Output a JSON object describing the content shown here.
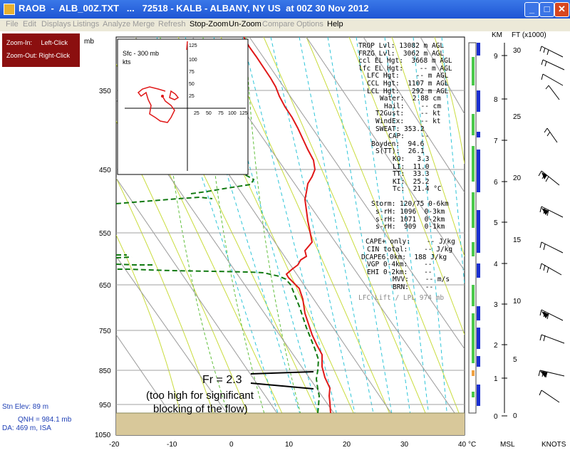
{
  "window": {
    "title": "RAOB  -  ALB_00Z.TXT   ...   72518 - KALB - ALBANY, NY US  at 00Z 30 Nov 2012",
    "buttons": {
      "minimize": "_",
      "maximize": "□",
      "close": "✕"
    }
  },
  "menu": [
    {
      "label": "File",
      "enabled": false
    },
    {
      "label": "Edit",
      "enabled": false
    },
    {
      "label": "Displays",
      "enabled": false
    },
    {
      "label": "Listings",
      "enabled": false
    },
    {
      "label": "Analyze",
      "enabled": false
    },
    {
      "label": "Merge",
      "enabled": false
    },
    {
      "label": "Refresh",
      "enabled": false
    },
    {
      "label": "Stop-Zoom",
      "enabled": true
    },
    {
      "label": "Un-Zoom",
      "enabled": true
    },
    {
      "label": "Compare",
      "enabled": false
    },
    {
      "label": "Options",
      "enabled": false
    },
    {
      "label": "Help",
      "enabled": true
    }
  ],
  "zoom_help": {
    "line1": "Zoom-In:     Left-Click",
    "line2": "Zoom-Out: Right-Click"
  },
  "station": {
    "elev": "Stn Elev: 89 m",
    "qnh": "QNH = 984.1 mb",
    "da": "DA: 469 m, ISA"
  },
  "axes": {
    "pressure_unit": "mb",
    "pressure_ticks": [
      "350",
      "450",
      "550",
      "650",
      "750",
      "850",
      "950",
      "1050"
    ],
    "temp_ticks": [
      "-20",
      "-10",
      "0",
      "10",
      "20",
      "30",
      "40"
    ],
    "temp_unit": "°C",
    "km_label": "KM",
    "ft_label": "FT (x1000)",
    "km_ticks": [
      "9",
      "8",
      "7",
      "6",
      "5",
      "4",
      "3",
      "2",
      "1",
      "0"
    ],
    "ft_ticks": [
      "30",
      "25",
      "20",
      "15",
      "10",
      "5",
      "0"
    ],
    "msl_label": "MSL",
    "knots_label": "KNOTS"
  },
  "hodograph": {
    "title": "Sfc - 300 mb",
    "units": "kts",
    "ticks": [
      "125",
      "100",
      "75",
      "50",
      "25"
    ],
    "xticks": [
      "25",
      "50",
      "75",
      "100",
      "125"
    ]
  },
  "indices": [
    "TROP Lvl: 13082 m AGL",
    "FRZG Lvl:  3062 m AGL",
    "ccl EL Hgt:  3668 m AGL",
    "lfc EL Hgt:    -- m AGL",
    "LFC Hgt:    -- m AGL",
    "CCL Hgt:  1107 m AGL",
    "LCL Hgt:   292 m AGL",
    "Water:  2.88 cm",
    "Hail:    -- cm",
    "T2Gust:    -- kt",
    "WindEx:    -- kt",
    "SWEAT: 353.2",
    "CAP:    --",
    "Boyden:  94.6",
    "S(TT):  26.1",
    "KO:   3.3",
    "LI:  11.0",
    "TT:  33.3",
    "KI:  25.2",
    "Tc:  21.4 °C",
    "",
    "Storm: 120/75 0-6km",
    "s-rH: 1096  0-3km",
    "s-rH: 1071  0-2km",
    "s-rH:  909  0-1km",
    "",
    "CAPE+ only:    -- J/kg",
    "CIN total:    -- J/kg",
    "DCAPE6.0km:  188 J/kg",
    "VGP 0-4km:    --",
    "EHI 0-2km:    --",
    "MVV:    -- m/s",
    "BRN:    --"
  ],
  "lfc_note": "LFC Lift / LPL 974 mb",
  "annotation": {
    "fr": "Fr = 2.3",
    "line1": "(too high for significant",
    "line2": "blocking of the flow)"
  }
}
